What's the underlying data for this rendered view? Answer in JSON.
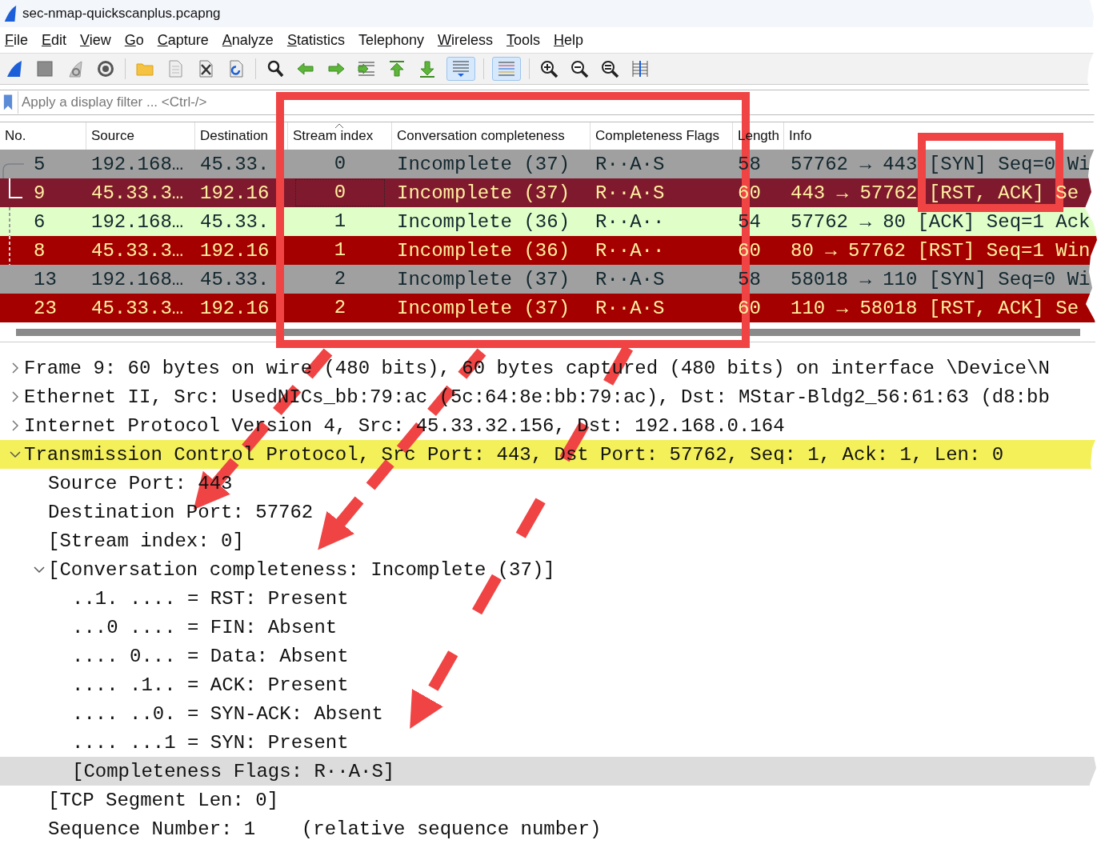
{
  "window": {
    "title": "sec-nmap-quickscanplus.pcapng"
  },
  "menu": [
    {
      "label": "File",
      "mnemonic": true
    },
    {
      "label": "Edit",
      "mnemonic": true
    },
    {
      "label": "View",
      "mnemonic": true
    },
    {
      "label": "Go",
      "mnemonic": true
    },
    {
      "label": "Capture",
      "mnemonic": true
    },
    {
      "label": "Analyze",
      "mnemonic": true
    },
    {
      "label": "Statistics",
      "mnemonic": true
    },
    {
      "label": "Telephony",
      "mnemonic": false
    },
    {
      "label": "Wireless",
      "mnemonic": true
    },
    {
      "label": "Tools",
      "mnemonic": true
    },
    {
      "label": "Help",
      "mnemonic": true
    }
  ],
  "toolbar": [
    {
      "on": false
    },
    {
      "on": false
    },
    {
      "on": false
    },
    {
      "on": false
    },
    {
      "on": false
    },
    {
      "on": false
    },
    {
      "on": false
    },
    {
      "on": false
    },
    {
      "on": false
    },
    {
      "on": false
    },
    {
      "on": false
    },
    {
      "on": false
    },
    {
      "on": false
    },
    {
      "on": false
    },
    {
      "on": true
    },
    {
      "on": true
    },
    {
      "on": false
    },
    {
      "on": false
    },
    {
      "on": false
    },
    {
      "on": false
    }
  ],
  "filter": {
    "placeholder": "Apply a display filter ... <Ctrl-/>"
  },
  "packet_list": {
    "columns": [
      {
        "label": "No.",
        "sorted": false
      },
      {
        "label": "Source",
        "sorted": false
      },
      {
        "label": "Destination",
        "sorted": false
      },
      {
        "label": "Stream index",
        "sorted": true
      },
      {
        "label": "Conversation completeness",
        "sorted": false
      },
      {
        "label": "Completeness Flags",
        "sorted": false
      },
      {
        "label": "Length",
        "sorted": false
      },
      {
        "label": "Info",
        "sorted": false
      }
    ],
    "rows": [
      {
        "no": "5",
        "source": "192.168…",
        "destination": "45.33.",
        "stream_index": "0",
        "completeness": "Incomplete (37)",
        "flags": "R··A·S",
        "length": "58",
        "info": "57762 → 443 [SYN] Seq=0 Wi",
        "color": "#a0a0a0",
        "selected": false,
        "kind": "first"
      },
      {
        "no": "9",
        "source": "45.33.3…",
        "destination": "192.16",
        "stream_index": "0",
        "completeness": "Incomplete (37)",
        "flags": "R··A·S",
        "length": "60",
        "info": "443 → 57762 [RST, ACK] Se",
        "color": "#7f1a2e",
        "selected": true,
        "kind": "last"
      },
      {
        "no": "6",
        "source": "192.168…",
        "destination": "45.33.",
        "stream_index": "1",
        "completeness": "Incomplete (36)",
        "flags": "R··A··",
        "length": "54",
        "info": "57762 → 80 [ACK] Seq=1 Ack",
        "color": "#e0ffc8",
        "selected": false,
        "kind": "middle"
      },
      {
        "no": "8",
        "source": "45.33.3…",
        "destination": "192.16",
        "stream_index": "1",
        "completeness": "Incomplete (36)",
        "flags": "R··A··",
        "length": "60",
        "info": "80 → 57762 [RST] Seq=1 Win",
        "color": "#a40000",
        "selected": false,
        "kind": "middle"
      },
      {
        "no": "13",
        "source": "192.168…",
        "destination": "45.33.",
        "stream_index": "2",
        "completeness": "Incomplete (37)",
        "flags": "R··A·S",
        "length": "58",
        "info": "58018 → 110 [SYN] Seq=0 Wi",
        "color": "#a0a0a0",
        "selected": false,
        "kind": "plain"
      },
      {
        "no": "23",
        "source": "45.33.3…",
        "destination": "192.16",
        "stream_index": "2",
        "completeness": "Incomplete (37)",
        "flags": "R··A·S",
        "length": "60",
        "info": "110 → 58018 [RST, ACK] Se",
        "color": "#a40000",
        "selected": false,
        "kind": "plain"
      }
    ]
  },
  "details": [
    {
      "label": "Frame 9: 60 bytes on wire (480 bits), 60 bytes captured (480 bits) on interface \\Device\\N",
      "expanded": false,
      "selected": false,
      "highlighted": false
    },
    {
      "label": "Ethernet II, Src: UsedNICs_bb:79:ac (5c:64:8e:bb:79:ac), Dst: MStar-Bldg2_56:61:63 (d8:bb",
      "expanded": false,
      "selected": false,
      "highlighted": false
    },
    {
      "label": "Internet Protocol Version 4, Src: 45.33.32.156, Dst: 192.168.0.164",
      "expanded": false,
      "selected": false,
      "highlighted": false
    },
    {
      "label": "Transmission Control Protocol, Src Port: 443, Dst Port: 57762, Seq: 1, Ack: 1, Len: 0",
      "expanded": true,
      "selected": false,
      "highlighted": true,
      "children": [
        {
          "label": "Source Port: 443",
          "selected": false,
          "highlighted": false
        },
        {
          "label": "Destination Port: 57762",
          "selected": false,
          "highlighted": false
        },
        {
          "label": "[Stream index: 0]",
          "selected": false,
          "highlighted": false
        },
        {
          "label": "[Conversation completeness: Incomplete (37)]",
          "expanded": true,
          "selected": false,
          "highlighted": false,
          "children": [
            {
              "label": "..1. .... = RST: Present",
              "selected": false,
              "highlighted": false
            },
            {
              "label": "...0 .... = FIN: Absent",
              "selected": false,
              "highlighted": false
            },
            {
              "label": ".... 0... = Data: Absent",
              "selected": false,
              "highlighted": false
            },
            {
              "label": ".... .1.. = ACK: Present",
              "selected": false,
              "highlighted": false
            },
            {
              "label": ".... ..0. = SYN-ACK: Absent",
              "selected": false,
              "highlighted": false
            },
            {
              "label": ".... ...1 = SYN: Present",
              "selected": false,
              "highlighted": false
            },
            {
              "label": "[Completeness Flags: R··A·S]",
              "selected": true,
              "highlighted": false
            }
          ]
        },
        {
          "label": "[TCP Segment Len: 0]",
          "selected": false,
          "highlighted": false
        },
        {
          "label": "Sequence Number: 1    (relative sequence number)",
          "selected": false,
          "highlighted": false
        }
      ]
    }
  ]
}
